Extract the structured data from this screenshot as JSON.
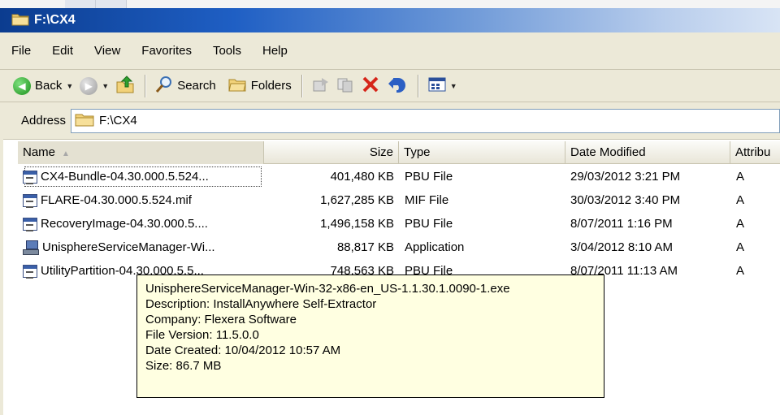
{
  "window": {
    "title": "F:\\CX4"
  },
  "menu": [
    {
      "label": "File"
    },
    {
      "label": "Edit"
    },
    {
      "label": "View"
    },
    {
      "label": "Favorites"
    },
    {
      "label": "Tools"
    },
    {
      "label": "Help"
    }
  ],
  "toolbar": {
    "back_label": "Back",
    "search_label": "Search",
    "folders_label": "Folders"
  },
  "address": {
    "label": "Address",
    "value": "F:\\CX4"
  },
  "columns": {
    "name": "Name",
    "size": "Size",
    "type": "Type",
    "date": "Date Modified",
    "attr": "Attribu"
  },
  "files": [
    {
      "name": "CX4-Bundle-04.30.000.5.524...",
      "size": "401,480 KB",
      "type": "PBU File",
      "date": "29/03/2012 3:21 PM",
      "attr": "A",
      "icon": "file-icon"
    },
    {
      "name": "FLARE-04.30.000.5.524.mif",
      "size": "1,627,285 KB",
      "type": "MIF File",
      "date": "30/03/2012 3:40 PM",
      "attr": "A",
      "icon": "file-icon"
    },
    {
      "name": "RecoveryImage-04.30.000.5....",
      "size": "1,496,158 KB",
      "type": "PBU File",
      "date": "8/07/2011 1:16 PM",
      "attr": "A",
      "icon": "file-icon"
    },
    {
      "name": "UnisphereServiceManager-Wi...",
      "size": "88,817 KB",
      "type": "Application",
      "date": "3/04/2012 8:10 AM",
      "attr": "A",
      "icon": "application-icon"
    },
    {
      "name": "UtilityPartition-04.30.000.5.5...",
      "size": "748,563 KB",
      "type": "PBU File",
      "date": "8/07/2011 11:13 AM",
      "attr": "A",
      "icon": "file-icon"
    }
  ],
  "tooltip": {
    "filename": "UnisphereServiceManager-Win-32-x86-en_US-1.1.30.1.0090-1.exe",
    "description": "Description: InstallAnywhere Self-Extractor",
    "company": "Company: Flexera Software",
    "version": "File Version: 11.5.0.0",
    "created": "Date Created: 10/04/2012 10:57 AM",
    "size": "Size: 86.7 MB"
  }
}
